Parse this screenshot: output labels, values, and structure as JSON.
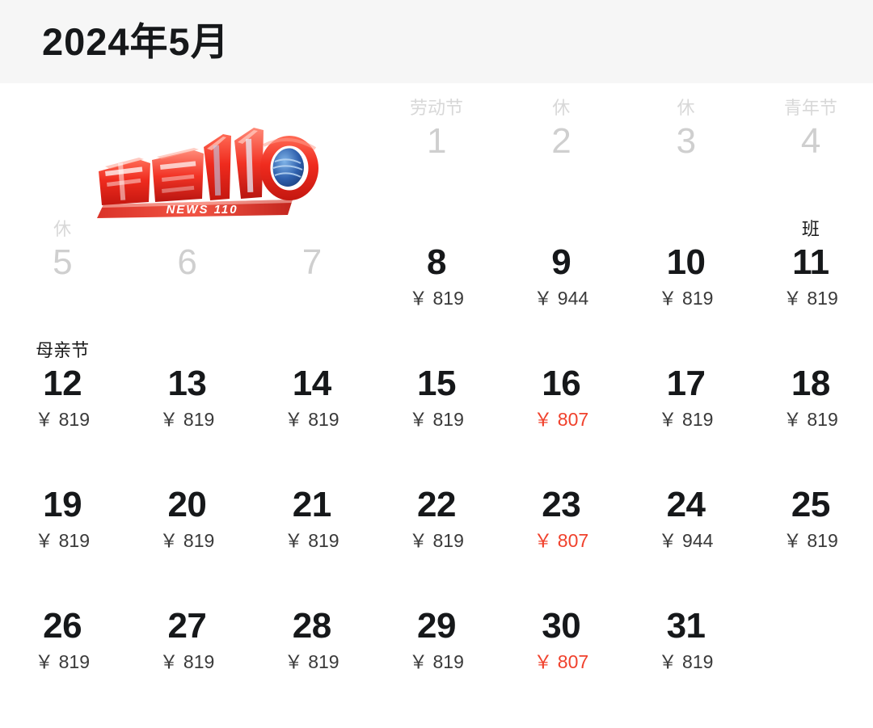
{
  "header": {
    "title": "2024年5月"
  },
  "logo": {
    "name": "news-110-logo",
    "main_text": "新闻110",
    "sub_text": "NEWS 110",
    "primary_color": "#e8241c",
    "highlight_color": "#ff6a5a",
    "globe_color": "#2e5fae"
  },
  "colors": {
    "text": "#16181a",
    "muted": "#cfcfcf",
    "price": "#3a3a3a",
    "price_low": "#f0412c",
    "header_band": "#f6f6f6"
  },
  "currency_symbol": "￥",
  "calendar": {
    "weeks": [
      [
        {
          "day": "",
          "label": "",
          "price": "",
          "state": "empty"
        },
        {
          "day": "",
          "label": "",
          "price": "",
          "state": "empty"
        },
        {
          "day": "",
          "label": "",
          "price": "",
          "state": "empty"
        },
        {
          "day": "1",
          "label": "劳动节",
          "price": "",
          "state": "disabled"
        },
        {
          "day": "2",
          "label": "休",
          "price": "",
          "state": "disabled"
        },
        {
          "day": "3",
          "label": "休",
          "price": "",
          "state": "disabled"
        },
        {
          "day": "4",
          "label": "青年节",
          "price": "",
          "state": "disabled"
        }
      ],
      [
        {
          "day": "5",
          "label": "休",
          "price": "",
          "state": "disabled"
        },
        {
          "day": "6",
          "label": "",
          "price": "",
          "state": "disabled"
        },
        {
          "day": "7",
          "label": "",
          "price": "",
          "state": "disabled"
        },
        {
          "day": "8",
          "label": "",
          "price": "￥ 819",
          "state": "active"
        },
        {
          "day": "9",
          "label": "",
          "price": "￥ 944",
          "state": "active"
        },
        {
          "day": "10",
          "label": "",
          "price": "￥ 819",
          "state": "active"
        },
        {
          "day": "11",
          "label": "班",
          "price": "￥ 819",
          "state": "workday"
        }
      ],
      [
        {
          "day": "12",
          "label": "母亲节",
          "price": "￥ 819",
          "state": "active"
        },
        {
          "day": "13",
          "label": "",
          "price": "￥ 819",
          "state": "active"
        },
        {
          "day": "14",
          "label": "",
          "price": "￥ 819",
          "state": "active"
        },
        {
          "day": "15",
          "label": "",
          "price": "￥ 819",
          "state": "active"
        },
        {
          "day": "16",
          "label": "",
          "price": "￥ 807",
          "state": "active",
          "price_low": true
        },
        {
          "day": "17",
          "label": "",
          "price": "￥ 819",
          "state": "active"
        },
        {
          "day": "18",
          "label": "",
          "price": "￥ 819",
          "state": "active"
        }
      ],
      [
        {
          "day": "19",
          "label": "",
          "price": "￥ 819",
          "state": "active"
        },
        {
          "day": "20",
          "label": "",
          "price": "￥ 819",
          "state": "active"
        },
        {
          "day": "21",
          "label": "",
          "price": "￥ 819",
          "state": "active"
        },
        {
          "day": "22",
          "label": "",
          "price": "￥ 819",
          "state": "active"
        },
        {
          "day": "23",
          "label": "",
          "price": "￥ 807",
          "state": "active",
          "price_low": true
        },
        {
          "day": "24",
          "label": "",
          "price": "￥ 944",
          "state": "active"
        },
        {
          "day": "25",
          "label": "",
          "price": "￥ 819",
          "state": "active"
        }
      ],
      [
        {
          "day": "26",
          "label": "",
          "price": "￥ 819",
          "state": "active"
        },
        {
          "day": "27",
          "label": "",
          "price": "￥ 819",
          "state": "active"
        },
        {
          "day": "28",
          "label": "",
          "price": "￥ 819",
          "state": "active"
        },
        {
          "day": "29",
          "label": "",
          "price": "￥ 819",
          "state": "active"
        },
        {
          "day": "30",
          "label": "",
          "price": "￥ 807",
          "state": "active",
          "price_low": true
        },
        {
          "day": "31",
          "label": "",
          "price": "￥ 819",
          "state": "active"
        },
        {
          "day": "",
          "label": "",
          "price": "",
          "state": "empty"
        }
      ]
    ]
  }
}
